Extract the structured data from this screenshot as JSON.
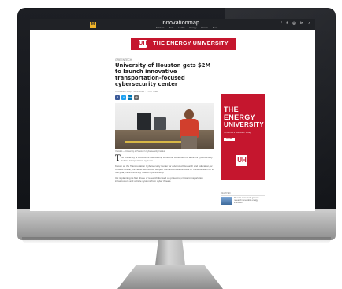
{
  "site": {
    "brand_text": "innovationmap",
    "brand_mark": "M",
    "nav_items": [
      "Startups",
      "Tech",
      "Health",
      "Energy",
      "Events",
      "More"
    ],
    "social_icons": [
      "facebook-icon",
      "twitter-icon",
      "instagram-icon",
      "linkedin-icon",
      "search-icon"
    ],
    "colors": {
      "header": "#202226",
      "brand_accent": "#f1b52a",
      "uh_red": "#c5162e"
    }
  },
  "banner": {
    "logo": "UH",
    "text": "THE ENERGY UNIVERSITY"
  },
  "article": {
    "section": "Greentech",
    "headline": "University of Houston gets $2M to launch innovative transportation-focused cybersecurity center",
    "byline": "Innovation Map · June 2022 · 2 min read",
    "share_buttons": [
      {
        "label": "f",
        "color": "#3b5998"
      },
      {
        "label": "t",
        "color": "#1da1f2"
      },
      {
        "label": "in",
        "color": "#0077b5"
      },
      {
        "label": "@",
        "color": "#666666"
      }
    ],
    "photo_caption": "Yourdon — University of Houston's Cybersecurity Institute",
    "dropcap": "T",
    "paragraph_1": "he University of Houston is now leading a national consortium to launch a cybersecurity hub for transportation systems.",
    "paragraph_2": "Known as the Transportation Cybersecurity Center for Advanced Research and Education, or CYBER-CARE, the center will receive support from the US Department of Transportation for its five-year, multi-university research partnership.",
    "paragraph_3": "UH is planning its first phase of research focused on protecting critical transportation infrastructure and vehicle systems from cyber threats."
  },
  "ad": {
    "line_1": "THE",
    "line_2": "ENERGY",
    "line_3": "UNIVERSITY",
    "tagline": "Tomorrow's Solutions Today",
    "cta": "LEARN MORE",
    "logo": "UH"
  },
  "related": {
    "title": "Related",
    "item_text": "Houston team lands grant to research renewable energy innovation"
  }
}
